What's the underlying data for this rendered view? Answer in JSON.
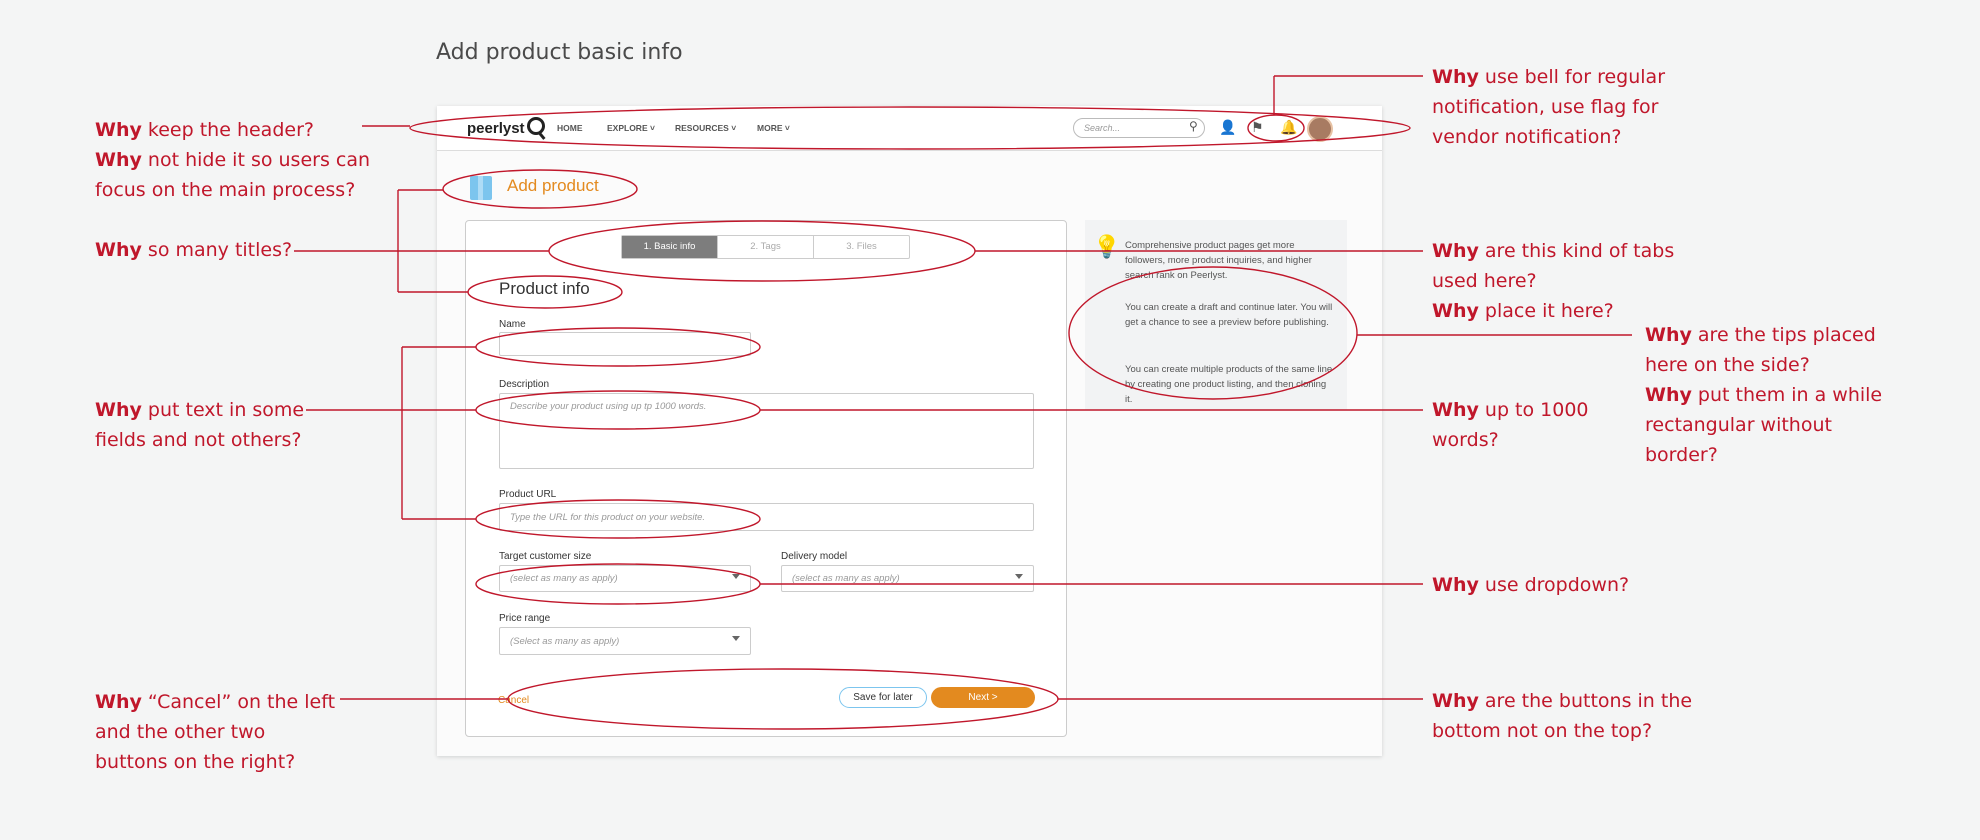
{
  "heading": "Add product basic info",
  "app": {
    "logo": {
      "text_main": "peer",
      "text_accent": "lyst"
    },
    "nav": [
      "HOME",
      "EXPLORE ˅",
      "RESOURCES ˅",
      "MORE ˅"
    ],
    "search_placeholder": "Search...",
    "page_title": "Add product",
    "tabs": [
      "1. Basic info",
      "2. Tags",
      "3. Files"
    ],
    "section_title": "Product info",
    "form": {
      "name_label": "Name",
      "name_value": "",
      "description_label": "Description",
      "description_placeholder": "Describe your product using up tp 1000 words.",
      "url_label": "Product URL",
      "url_placeholder": "Type the URL for this product on your website.",
      "target_label": "Target customer size",
      "target_placeholder": "(select as many as apply)",
      "delivery_label": "Delivery model",
      "delivery_placeholder": "(select as many as apply)",
      "price_label": "Price range",
      "price_placeholder": "(Select as many as apply)"
    },
    "buttons": {
      "cancel": "Cancel",
      "save": "Save for later",
      "next": "Next >"
    },
    "tips": [
      "Comprehensive product pages get more followers, more product inquiries, and higher search rank on Peerlyst.",
      "You can create a draft and continue later. You will get a chance to see a preview before publishing.",
      "You can create multiple products of the same line by creating one product listing, and then cloning it."
    ]
  },
  "annotations": {
    "header": [
      {
        "b": "Why",
        "t": " keep the header?"
      },
      {
        "b": "Why",
        "t": " not hide it so users can"
      },
      {
        "b": "",
        "t": "focus on the main process?"
      }
    ],
    "titles": [
      {
        "b": "Why",
        "t": " so many titles?"
      }
    ],
    "text_fields": [
      {
        "b": "Why",
        "t": " put text in some"
      },
      {
        "b": "",
        "t": "fields and not others?"
      }
    ],
    "cancel": [
      {
        "b": "Why",
        "t": " “Cancel” on the left"
      },
      {
        "b": "",
        "t": "and the other two"
      },
      {
        "b": "",
        "t": "buttons on the right?"
      }
    ],
    "bell": [
      {
        "b": "Why",
        "t": " use bell for regular"
      },
      {
        "b": "",
        "t": "notification, use flag for"
      },
      {
        "b": "",
        "t": "vendor notification?"
      }
    ],
    "tabs": [
      {
        "b": "Why",
        "t": " are this kind of tabs"
      },
      {
        "b": "",
        "t": "used here?"
      },
      {
        "b": "Why",
        "t": " place it here?"
      }
    ],
    "tips": [
      {
        "b": "Why",
        "t": " are the tips placed"
      },
      {
        "b": "",
        "t": "here on the side?"
      },
      {
        "b": "Why",
        "t": " put them in a while"
      },
      {
        "b": "",
        "t": "rectangular without"
      },
      {
        "b": "",
        "t": "border?"
      }
    ],
    "words": [
      {
        "b": "Why",
        "t": " up to 1000"
      },
      {
        "b": "",
        "t": "words?"
      }
    ],
    "dropdown": [
      {
        "b": "Why",
        "t": " use dropdown?"
      }
    ],
    "buttons": [
      {
        "b": "Why",
        "t": " are the buttons in the"
      },
      {
        "b": "",
        "t": "bottom not on the top?"
      }
    ]
  },
  "colors": {
    "annotation": "#c0172b",
    "accent": "#e38a1f",
    "tab_active": "#7d7d7d",
    "icon_blue": "#7cc5ee"
  }
}
